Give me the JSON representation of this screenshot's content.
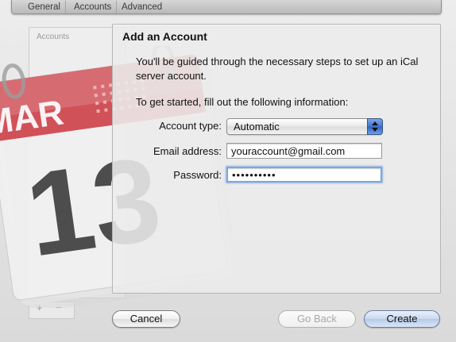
{
  "background_window": {
    "tabs": [
      "General",
      "Accounts",
      "Advanced"
    ],
    "sidebar_title": "Accounts",
    "sidebar_entry": "",
    "calendar_icon": {
      "month": "MAR",
      "day": "13",
      "icon": "ical-calendar-icon"
    }
  },
  "sheet": {
    "title": "Add an Account",
    "intro": "You'll be guided through the necessary steps to set up an iCal server account.",
    "instructions": "To get started, fill out the following information:",
    "account_type": {
      "label": "Account type:",
      "value": "Automatic"
    },
    "email": {
      "label": "Email address:",
      "value": "youraccount@gmail.com"
    },
    "password": {
      "label": "Password:",
      "masked_value": "••••••••••"
    }
  },
  "buttons": {
    "cancel": "Cancel",
    "go_back": "Go Back",
    "create": "Create"
  },
  "colors": {
    "calendar_red": "#cf4b53",
    "focus_ring": "#7ea6da",
    "default_button": "#c9d8ef"
  }
}
